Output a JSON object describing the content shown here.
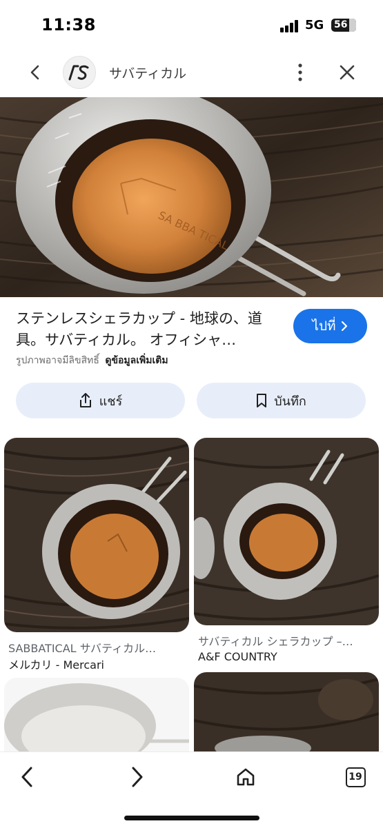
{
  "status_bar": {
    "time": "11:38",
    "network": "5G",
    "battery": "56"
  },
  "header": {
    "site_name": "サバティカル",
    "logo_text": "ʃS",
    "icons": [
      "back-arrow-icon",
      "site-logo-icon",
      "more-vert-icon",
      "close-icon"
    ]
  },
  "result": {
    "title": "ステンレスシェラカップ - 地球の、道具。サバティカル。 オフィシャ…",
    "visit_label": "ไปที่",
    "copyright_note": "รูปภาพอาจมีลิขสิทธิ์",
    "more_info_label": "ดูข้อมูลเพิ่มเติม",
    "share_label": "แชร์",
    "save_label": "บันทึก"
  },
  "related": [
    {
      "title": "SABBATICAL サバティカル…",
      "source": "メルカリ - Mercari"
    },
    {
      "title": "サバティカル シェラカップ –…",
      "source": "A&F COUNTRY"
    },
    {
      "title": "",
      "source": ""
    },
    {
      "title": "",
      "source": ""
    }
  ],
  "bottom_nav": {
    "tabs_count": "19",
    "icons": [
      "back-icon",
      "forward-icon",
      "home-icon",
      "tabs-icon"
    ]
  },
  "colors": {
    "accent": "#1a73e8",
    "chip_bg": "#e8eef9",
    "wood_dark": "#3a2e24",
    "copper": "#c97a35"
  }
}
